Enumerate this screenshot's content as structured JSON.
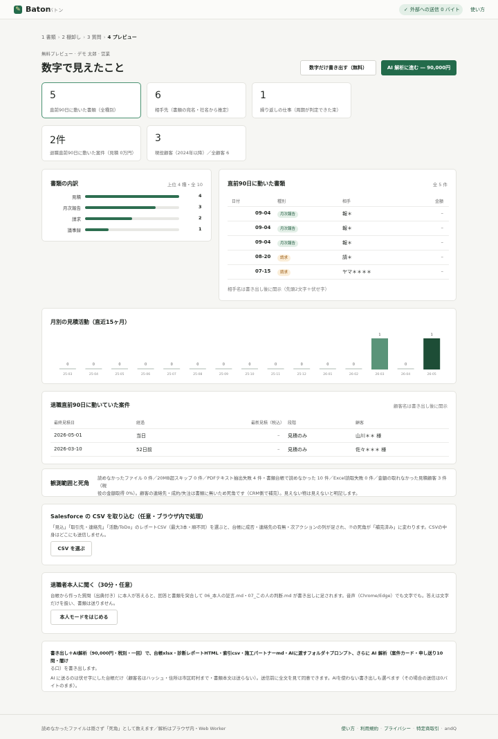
{
  "header": {
    "brand": "Baton",
    "brand_sub": "バトン",
    "send_status": "外部への送信 0 バイト",
    "howto": "使い方"
  },
  "breadcrumb": [
    "1 書類",
    "2 棚卸し",
    "3 質問",
    "4 プレビュー"
  ],
  "meta": "無料プレビュー · デモ 太郎 · 営業",
  "page_title": "数字で見えたこと",
  "actions": {
    "free_export": "数字だけ書き出す（無料）",
    "ai_proceed": "AI 解析に進む ― 90,000円"
  },
  "stats": [
    {
      "num": "5",
      "label": "直前90日に動いた書類（全種別）"
    },
    {
      "num": "6",
      "label": "相手先（書類の宛名・社名から推定）"
    },
    {
      "num": "1",
      "label": "繰り返しの仕事（周期が判定できた束）"
    },
    {
      "num": "2件",
      "label": "退職直前90日に動いた案件（見積 0万円）"
    },
    {
      "num": "3",
      "label": "現役顧客（2024年以降）／全顧客 6"
    }
  ],
  "breakdown": {
    "title": "書類の内訳",
    "side": "上位 4 種・全 10",
    "items": [
      {
        "label": "見積",
        "value": 4
      },
      {
        "label": "月次報告",
        "value": 3
      },
      {
        "label": "請求",
        "value": 2
      },
      {
        "label": "議事録",
        "value": 1
      }
    ],
    "max": 4
  },
  "recent_docs": {
    "title": "直前90日に動いた書類",
    "side": "全 5 件",
    "columns": [
      "日付",
      "種別",
      "相手",
      "金額"
    ],
    "rows": [
      {
        "date": "09-04",
        "type": "月次報告",
        "tone": "green",
        "party": "報＊",
        "amount": "–"
      },
      {
        "date": "09-04",
        "type": "月次報告",
        "tone": "green",
        "party": "報＊",
        "amount": "–"
      },
      {
        "date": "09-04",
        "type": "月次報告",
        "tone": "green",
        "party": "報＊",
        "amount": "–"
      },
      {
        "date": "08-20",
        "type": "請求",
        "tone": "amber",
        "party": "請＊",
        "amount": "–"
      },
      {
        "date": "07-15",
        "type": "請求",
        "tone": "amber",
        "party": "ヤマ＊＊＊＊",
        "amount": "–"
      }
    ],
    "note": "相手名は書き出し後に開示（先頭2文字＋伏せ字）"
  },
  "monthly": {
    "title": "月別の見積活動（直近15ヶ月）"
  },
  "chart_data": {
    "type": "bar",
    "title": "月別の見積活動（直近15ヶ月）",
    "categories": [
      "25-03",
      "25-04",
      "25-05",
      "25-06",
      "25-07",
      "25-08",
      "25-09",
      "25-10",
      "25-11",
      "25-12",
      "26-01",
      "26-02",
      "26-03",
      "26-04",
      "26-05"
    ],
    "values": [
      0,
      0,
      0,
      0,
      0,
      0,
      0,
      0,
      0,
      0,
      0,
      0,
      1,
      0,
      1
    ],
    "ylim": [
      0,
      1
    ],
    "grid": false,
    "colors": {
      "bar": "#5a9479",
      "latest": "#1d4d36",
      "zero": "#d6dcd8"
    }
  },
  "pre_exit": {
    "title": "退職直前90日に動いていた案件",
    "side": "顧客名は書き出し後に開示",
    "columns": [
      "最終見積日",
      "経過",
      "最新見積（税込）",
      "段階",
      "顧客"
    ],
    "rows": [
      {
        "date": "2026-05-01",
        "elapsed": "当日",
        "amount": "–",
        "stage": "見積のみ",
        "client": "山川＊＊ 様"
      },
      {
        "date": "2026-03-10",
        "elapsed": "52日前",
        "amount": "–",
        "stage": "見積のみ",
        "client": "佐々＊＊＊ 様"
      }
    ]
  },
  "observation": {
    "title": "観測範囲と死角",
    "line1": "読めなかったファイル 0 件／20MB超スキップ 0 件／PDFテキスト抽出失敗 4 件・書類台帳で読めなかった 10 件／Excel読取失敗 0 件／金額の取れなかった見積顧客 3 件（現",
    "line2": "役の金額取得 0%）。顧客の連絡先・成約/失注は書類に無いため死角です（CRM側で補完）。見えない物は見えないと明記します。"
  },
  "salesforce": {
    "title": "Salesforce の CSV を取り込む（任意・ブラウザ内で処理）",
    "line1": "「見込」「取引先・連絡先」「活動/ToDo」のレポートCSV（最大3本・順不同）を選ぶと、台帳に成否・連絡先の有無・次アクションの列が足され、⑦の死角が「補完済み」に変わります。CSVの中",
    "line2": "身はどこにも送信しません。",
    "button": "CSV を選ぶ"
  },
  "interview": {
    "title": "退職者本人に聞く（30分・任意）",
    "line1": "台帳から作った質問（出典付き）に本人が答えると、回答と書類を突合して 06_本人の証言.md・07_この人の判断.md が書き出しに足されます。音声（Chrome/Edge）でも文字でも。答えは文字",
    "line2": "だけを扱い、書類は送りません。",
    "button": "本人モードをはじめる"
  },
  "export_info": {
    "line1": "書き出し＋AI解析（90,000円・税別・一回）で、台帳xlsx・診断レポートHTML・索引csv・施工パートナーmd・AIに渡すフォルダ＋プロンプト、さらに AI 解析（案件カード・申し送り10問・闇け",
    "line2": "る口）を書き出します。",
    "line3": "AI に送るのは伏せ字にした台帳だけ（顧客名はハッシュ・住所は市区町村まで・書類本文は送らない）。送信前に全文を見て同意できます。AIを使わない書き出しも選べます（その場合の送信は0バ",
    "line4": "イトのまま）。"
  },
  "footer": {
    "left": "読めなかったファイルは隠さず「死角」として数えます／解析はブラウザ内・Web Worker",
    "links": [
      "使い方",
      "利用規約",
      "プライバシー",
      "特定商取引"
    ],
    "credit": "andQ"
  }
}
